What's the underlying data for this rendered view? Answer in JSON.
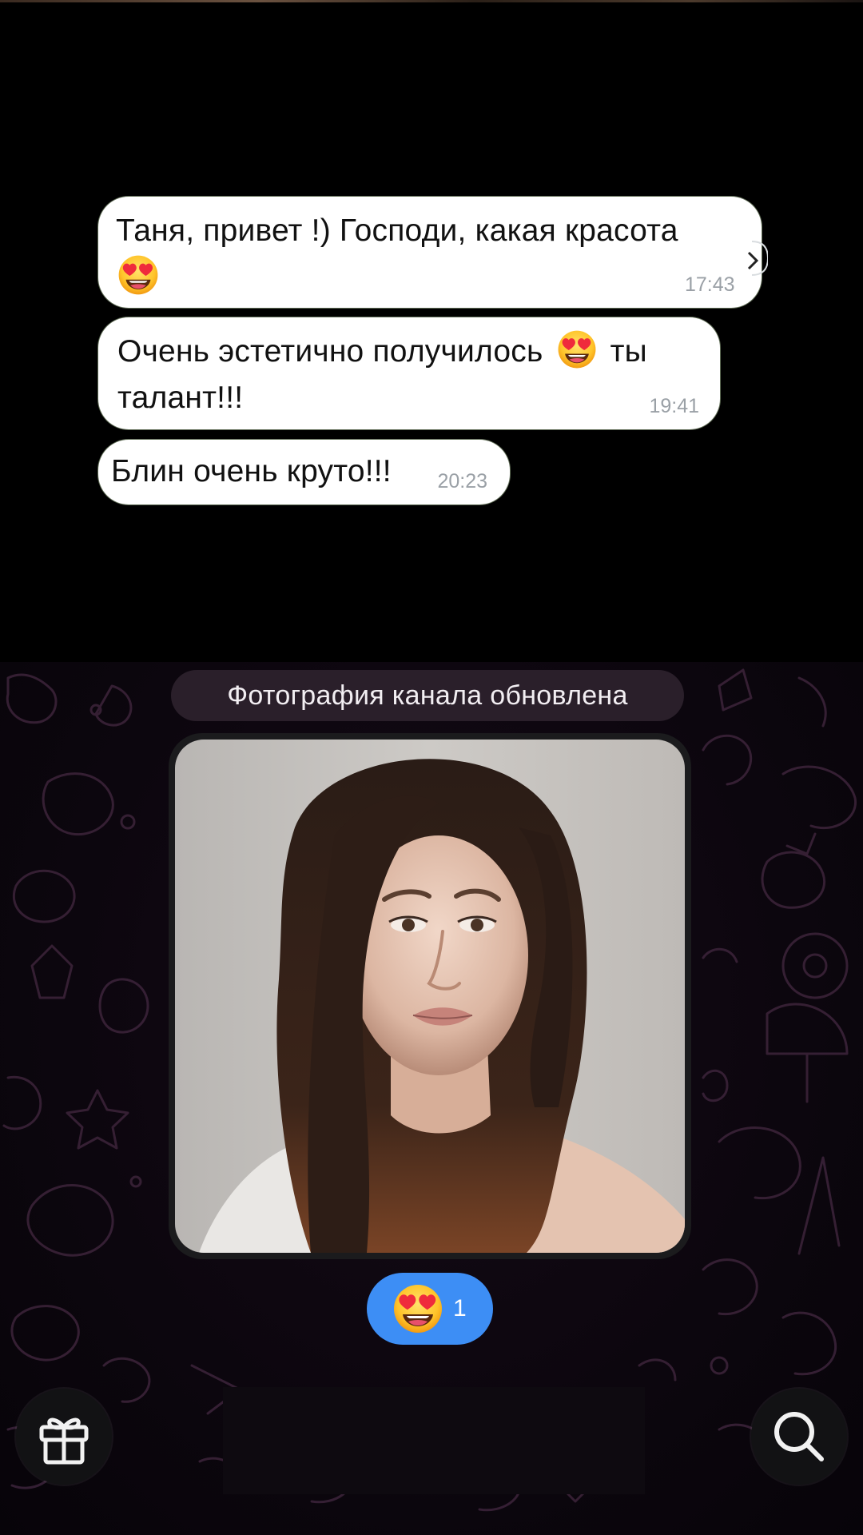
{
  "messages": [
    {
      "text": "Таня, привет !) Господи, какая красота",
      "emoji": "heart-eyes",
      "time": "17:43"
    },
    {
      "text_before": "Очень эстетично получилось",
      "emoji": "heart-eyes",
      "text_after": "ты талант!!!",
      "time": "19:41"
    },
    {
      "text": "Блин очень круто!!!",
      "time": "20:23"
    }
  ],
  "service_message": "Фотография канала обновлена",
  "reaction": {
    "emoji": "heart-eyes",
    "count": "1"
  },
  "buttons": {
    "gift_icon": "gift-icon",
    "search_icon": "search-icon"
  },
  "colors": {
    "bubble": "#ffffff",
    "reaction": "#3d8ef5",
    "background": "#000000",
    "pill": "#2a1f2a"
  }
}
